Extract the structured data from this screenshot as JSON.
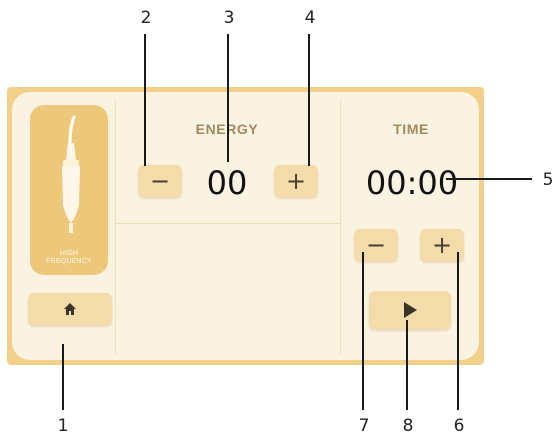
{
  "callouts": [
    "1",
    "2",
    "3",
    "4",
    "5",
    "6",
    "7",
    "8"
  ],
  "device": {
    "label": "HIGH\nFREQUENCY"
  },
  "energy": {
    "caption": "ENERGY",
    "value": "00",
    "minus_symbol": "−",
    "plus_symbol": "+"
  },
  "time": {
    "caption": "TIME",
    "value": "00:00",
    "minus_symbol": "−",
    "plus_symbol": "+"
  },
  "icons": {
    "home": "home-icon",
    "play": "play-icon",
    "handpiece": "handpiece-icon"
  },
  "colors": {
    "frame": "#f2d089",
    "panel": "#fbf3e2",
    "button": "#f3dca9",
    "device_card": "#eec87a"
  }
}
